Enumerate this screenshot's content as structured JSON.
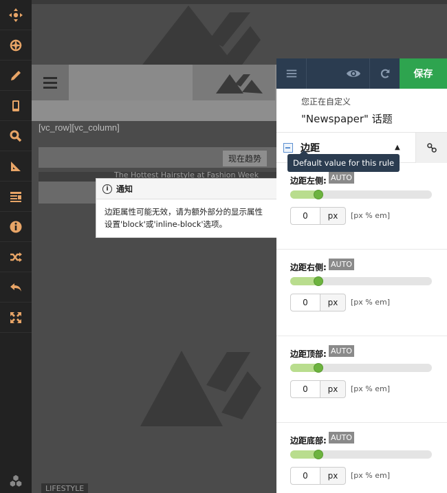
{
  "toolbar": {
    "items": [
      {
        "icon": "move-icon"
      },
      {
        "icon": "compass-icon"
      },
      {
        "icon": "pencil-icon"
      },
      {
        "icon": "mobile-icon"
      },
      {
        "icon": "search-icon"
      },
      {
        "icon": "ruler-icon"
      },
      {
        "icon": "layout-icon"
      },
      {
        "icon": "info-icon"
      },
      {
        "icon": "shuffle-icon"
      },
      {
        "icon": "undo-icon"
      },
      {
        "icon": "expand-icon"
      }
    ],
    "bottom_icon": "hexagons-icon",
    "accent": "#e8a567"
  },
  "preview": {
    "shortcode": "[vc_row][vc_column]",
    "trend_label": "现在趋势",
    "headline": "The Hottest Hairstyle at Fashion Week",
    "bottom_tag": "LIFESTYLE"
  },
  "notice": {
    "title": "通知",
    "body": "边距属性可能无效，请为额外部分的显示属性设置'block'或'inline-block'选项。"
  },
  "panel": {
    "save_label": "保存",
    "customizing_label": "您正在自定义",
    "theme_name": "\"Newspaper\" 话题",
    "section_title": "边距",
    "section_toggle": "▲",
    "tooltip": "Default value for this rule",
    "controls": [
      {
        "label": "边距左侧:",
        "badge": "AUTO",
        "value": "0",
        "unit": "px",
        "hint": "[px % em]",
        "slider_fraction": 0.2
      },
      {
        "label": "边距右侧:",
        "badge": "AUTO",
        "value": "0",
        "unit": "px",
        "hint": "[px % em]",
        "slider_fraction": 0.2
      },
      {
        "label": "边距顶部:",
        "badge": "AUTO",
        "value": "0",
        "unit": "px",
        "hint": "[px % em]",
        "slider_fraction": 0.2
      },
      {
        "label": "边距底部:",
        "badge": "AUTO",
        "value": "0",
        "unit": "px",
        "hint": "[px % em]",
        "slider_fraction": 0.2
      }
    ],
    "header_color": "#2b3c50",
    "save_color": "#2ea44f"
  }
}
